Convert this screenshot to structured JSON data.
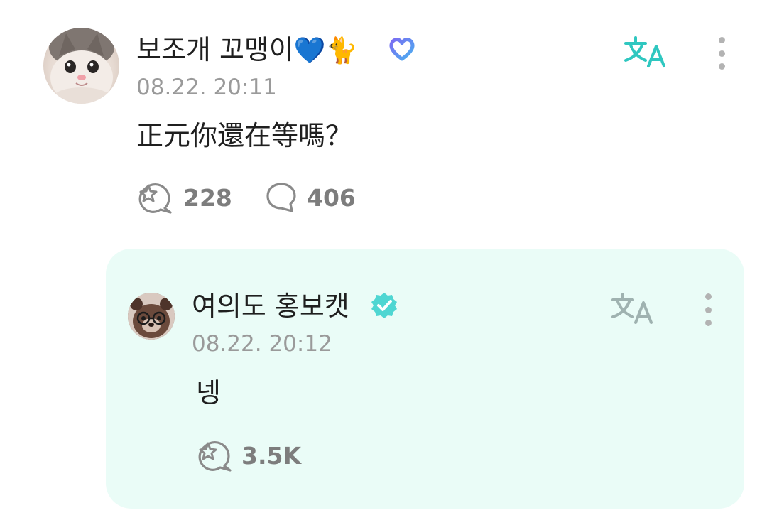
{
  "post": {
    "author": "보조개 꼬맹이",
    "author_emojis": [
      "💙",
      "🐈"
    ],
    "badge_icon": "heart-badge-icon",
    "timestamp": "08.22. 20:11",
    "content": "正元你還在等嗎？",
    "likes": "228",
    "comments": "406",
    "translate_icon": "translate-icon",
    "more_icon": "more-vertical-icon",
    "like_icon": "like-sparkle-icon",
    "comment_icon": "comment-bubble-icon"
  },
  "reply": {
    "author": "여의도 홍보캣",
    "verified_icon": "verified-badge-icon",
    "timestamp": "08.22. 20:12",
    "content": "넹",
    "likes": "3.5K",
    "translate_icon": "translate-icon",
    "more_icon": "more-vertical-icon",
    "like_icon": "like-sparkle-icon"
  },
  "colors": {
    "accent_teal": "#2fc7c0",
    "reply_background": "#eafcf7",
    "muted_gray": "#9a9a9a",
    "verified_teal": "#4fd6d2"
  }
}
